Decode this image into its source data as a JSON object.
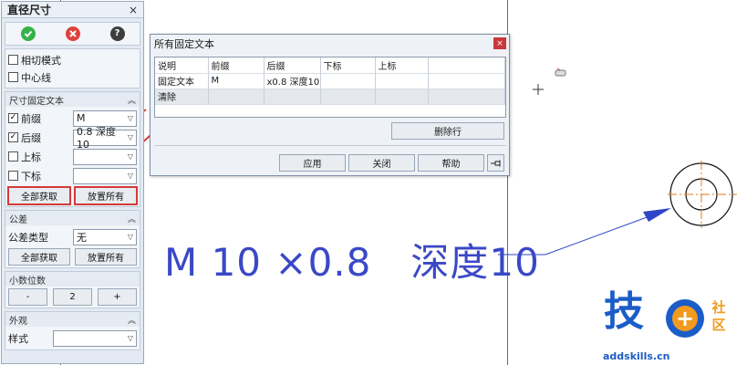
{
  "panel": {
    "title": "直径尺寸",
    "close_glyph": "×",
    "icons": {
      "ok": "check-circle-icon",
      "cancel": "x-circle-icon",
      "help": "question-circle-icon"
    },
    "options": [
      {
        "label": "相切模式",
        "checked": false
      },
      {
        "label": "中心线",
        "checked": false
      }
    ],
    "fixed_text": {
      "title": "尺寸固定文本",
      "prefix": {
        "label": "前缀",
        "checked": true,
        "value": "M"
      },
      "suffix": {
        "label": "后缀",
        "checked": true,
        "value": "0.8 深度10"
      },
      "superscript": {
        "label": "上标",
        "checked": false,
        "value": ""
      },
      "subscript": {
        "label": "下标",
        "checked": false,
        "value": ""
      },
      "get_all_label": "全部获取",
      "place_all_label": "放置所有"
    },
    "tolerance": {
      "title": "公差",
      "type_label": "公差类型",
      "type_value": "无",
      "get_all_label": "全部获取",
      "place_all_label": "放置所有"
    },
    "decimals": {
      "title": "小数位数",
      "minus": "-",
      "value": "2",
      "plus": "+"
    },
    "appearance": {
      "title": "外观",
      "style_label": "样式",
      "style_value": ""
    }
  },
  "dialog": {
    "title": "所有固定文本",
    "close_glyph": "×",
    "columns": [
      "说明",
      "前缀",
      "后缀",
      "下标",
      "上标"
    ],
    "rows": [
      [
        "固定文本",
        "M",
        "x0.8 深度10",
        "",
        ""
      ],
      [
        "清除",
        "",
        "",
        "",
        ""
      ]
    ],
    "delete_row_label": "删除行",
    "apply_label": "应用",
    "close_label": "关闭",
    "help_label": "帮助",
    "pin_icon": "pin-icon"
  },
  "drawing": {
    "dimension_text": "M 10 ×0.8   深度10",
    "leader_color": "#2f46c8",
    "center_mark_color": "#e07b1a"
  },
  "logo": {
    "main": "技",
    "plus": "+",
    "side_top": "社",
    "side_bottom": "区",
    "url": "addskills.cn"
  },
  "colors": {
    "highlight": "#d33a3a",
    "ok": "#35b24a",
    "cancel": "#e0413c",
    "brand_blue": "#1a5dc8",
    "brand_orange": "#f29a1f"
  }
}
